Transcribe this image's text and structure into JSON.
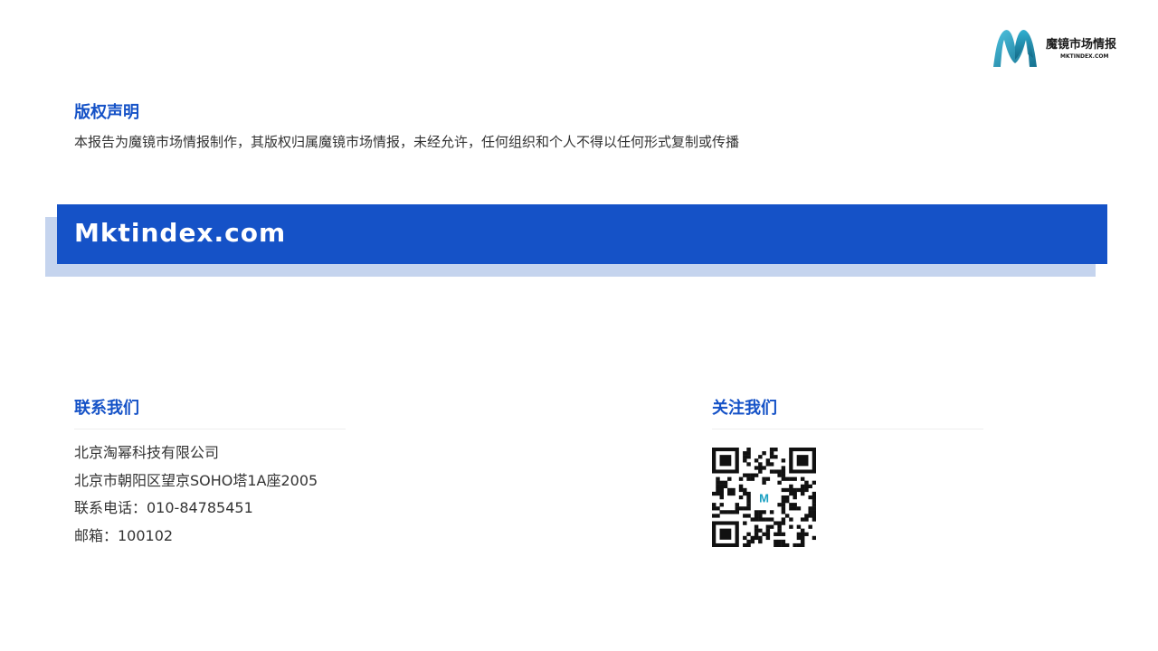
{
  "brand": {
    "name_cn": "魔镜市场情报",
    "name_en": "MKTINDEX.COM",
    "colors": {
      "primary": "#1552c7",
      "band_shadow": "#c5d4ee",
      "logo_teal": "#1aa0c2"
    }
  },
  "copyright": {
    "title": "版权声明",
    "text": "本报告为魔镜市场情报制作，其版权归属魔镜市场情报，未经允许，任何组织和个人不得以任何形式复制或传播"
  },
  "banner": {
    "text": "Mktindex.com"
  },
  "contact": {
    "title": "联系我们",
    "lines": [
      "北京淘幂科技有限公司",
      "北京市朝阳区望京SOHO塔1A座2005",
      "联系电话：010-84785451",
      "邮箱：100102"
    ]
  },
  "follow": {
    "title": "关注我们",
    "qr_icon": "qr-code-icon"
  }
}
